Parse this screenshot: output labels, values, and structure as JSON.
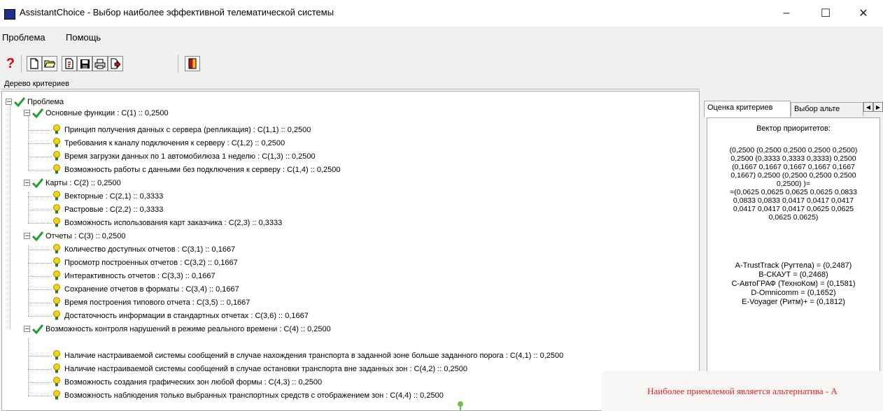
{
  "window": {
    "title": "AssistantChoice  -  Выбор наиболее эффективной телематической системы",
    "minimize": "–",
    "maximize": "☐",
    "close": "✕"
  },
  "menu": [
    "Проблема",
    "Помощь"
  ],
  "toolbar": {
    "icons": [
      "help-icon",
      "new-file-icon",
      "open-folder-icon",
      "open-file-icon",
      "save-icon",
      "print-icon",
      "export-icon",
      "exit-icon"
    ],
    "help_label": "?"
  },
  "tree_panel": {
    "title": "Дерево критериев",
    "nodes": [
      {
        "label": "Проблема"
      },
      {
        "label": "Основные функции : C(1) :: 0,2500"
      },
      {
        "label": "Принцип получения данных с сервера (репликация) : C(1,1) :: 0,2500"
      },
      {
        "label": "Требования к каналу подключения к серверу : C(1,2) :: 0,2500"
      },
      {
        "label": "Время загрузки данных по 1 автомобилюза 1 неделю : C(1,3) :: 0,2500"
      },
      {
        "label": "Возможность работы с  данными без подключения  к серверу : C(1,4) :: 0,2500"
      },
      {
        "label": "Карты : C(2) :: 0,2500"
      },
      {
        "label": "Векторные : C(2,1) :: 0,3333"
      },
      {
        "label": "Растровые : C(2,2) :: 0,3333"
      },
      {
        "label": "Возможность использования карт заказчика : C(2,3) :: 0,3333"
      },
      {
        "label": "Отчеты : C(3) :: 0,2500"
      },
      {
        "label": "Количество доступных отчетов : C(3,1) :: 0,1667"
      },
      {
        "label": "Просмотр построенных  отчетов : C(3,2) :: 0,1667"
      },
      {
        "label": "Интерактивность отчетов : C(3,3) :: 0,1667"
      },
      {
        "label": "Сохранение отчетов в форматы : C(3,4) :: 0,1667"
      },
      {
        "label": "Время построения типового отчета : C(3,5) :: 0,1667"
      },
      {
        "label": "Достаточность информации в стандартных  отчетах : C(3,6) :: 0,1667"
      },
      {
        "label": "Возможность контроля нарушений в режиме реального времени : C(4) :: 0,2500"
      },
      {
        "label": "Наличие настраиваемой  системы сообщений в случае нахождения транспорта в заданной зоне больше заданного порога : C(4,1) :: 0,2500"
      },
      {
        "label": "Наличие настраиваемой системы сообщений в случае остановки транспорта вне заданных зон : C(4,2) :: 0,2500"
      },
      {
        "label": "Возможность создания графических зон любой формы : C(4,3) :: 0,2500"
      },
      {
        "label": "Возможность наблюдения только выбранных транспортных средств с отображением  зон : C(4,4) :: 0,2500"
      }
    ]
  },
  "right_panel": {
    "tabs": [
      "Оценка критериев",
      "Выбор альте"
    ],
    "priority_title": "Вектор приоритетов:",
    "vector_lines": [
      "(0,2500 (0,2500 0,2500 0,2500 0,2500)",
      "0,2500 (0,3333 0,3333 0,3333) 0,2500",
      "(0,1667 0,1667 0,1667 0,1667 0,1667",
      "0,1667) 0,2500 (0,2500 0,2500 0,2500",
      "0,2500) )=",
      "=(0,0625 0,0625 0,0625 0,0625 0,0833",
      "0,0833 0,0833 0,0417 0,0417 0,0417",
      "0,0417 0,0417 0,0417 0,0625 0,0625",
      "0,0625 0,0625)"
    ],
    "alternatives": [
      "A-TrustTrack (Ругтела) = (0,2487)",
      "B-СКАУТ = (0,2468)",
      "C-АвтоГРАФ (ТехноКом) = (0,1581)",
      "D-Omnicomm = (0,1652)",
      "E-Voyager (Ритм)+ = (0,1812)"
    ]
  },
  "result": {
    "text": "Наиболее приемлемой является альтернатива  -  A",
    "color": "#e02020"
  }
}
